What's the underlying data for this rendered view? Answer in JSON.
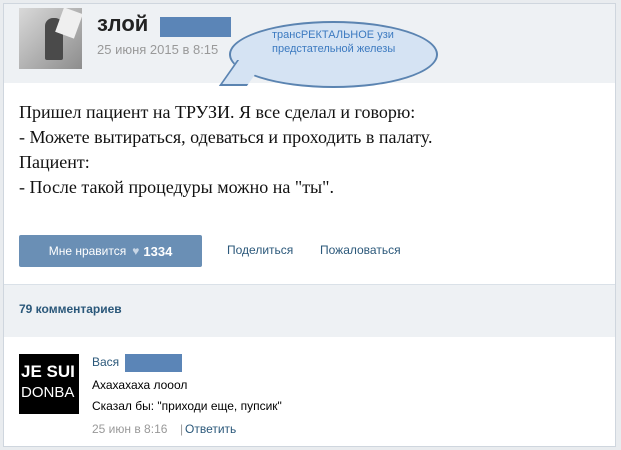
{
  "post": {
    "author_name": "злой",
    "date": "25 июня 2015 в 8:15",
    "speech_bubble": "трансРЕКТАЛЬНОЕ узи предстательной железы",
    "body_lines": [
      "Пришел пациент на ТРУЗИ. Я все сделал и говорю:",
      "- Можете вытираться, одеваться и проходить в палату.",
      "Пациент:",
      "- После такой процедуры можно на \"ты\"."
    ],
    "like_label": "Мне нравится",
    "like_count": "1334",
    "share_label": "Поделиться",
    "report_label": "Пожаловаться"
  },
  "comments": {
    "count_label": "79 комментариев",
    "items": [
      {
        "author": "Вася",
        "avatar_text_line1": "JE SUI",
        "avatar_text_line2": "DONBA",
        "lines": [
          "Ахахахаха лооол",
          "Сказал бы: \"приходи еще, пупсик\""
        ],
        "date": "25 июн в 8:16",
        "reply_label": "Ответить"
      }
    ]
  },
  "colors": {
    "link": "#2b587a",
    "button": "#6a8fb5",
    "redaction": "#5b85b7",
    "bubble_fill": "#d5e3f3",
    "bubble_text": "#3c7ac0"
  }
}
